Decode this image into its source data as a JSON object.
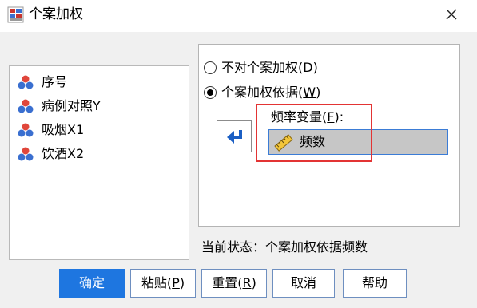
{
  "window": {
    "title": "个案加权"
  },
  "variables": [
    {
      "label": "序号"
    },
    {
      "label": "病例对照Y"
    },
    {
      "label": "吸烟X1"
    },
    {
      "label": "饮酒X2"
    }
  ],
  "weighting": {
    "option_none": {
      "text": "不对个案加权(",
      "mnemonic": "D",
      "suffix": ")",
      "selected": false
    },
    "option_by": {
      "text": "个案加权依据(",
      "mnemonic": "W",
      "suffix": ")",
      "selected": true
    },
    "frequency_label": {
      "text": "频率变量(",
      "mnemonic": "F",
      "suffix": "):"
    },
    "frequency_value": "频数"
  },
  "status": "当前状态：个案加权依据频数",
  "buttons": {
    "ok": {
      "text": "确定"
    },
    "paste": {
      "text": "粘贴(",
      "mnemonic": "P",
      "suffix": ")"
    },
    "reset": {
      "text": "重置(",
      "mnemonic": "R",
      "suffix": ")"
    },
    "cancel": {
      "text": "取消"
    },
    "help": {
      "text": "帮助"
    }
  },
  "colors": {
    "primary_button": "#1e76e0",
    "highlight_box": "#e33434",
    "field_border": "#3b7cd6"
  },
  "icons": {
    "app": "weight-cases-app-icon",
    "close": "close-icon",
    "variable": "nominal-variable-icon",
    "move": "move-left-arrow-icon",
    "scale": "scale-ruler-icon"
  }
}
